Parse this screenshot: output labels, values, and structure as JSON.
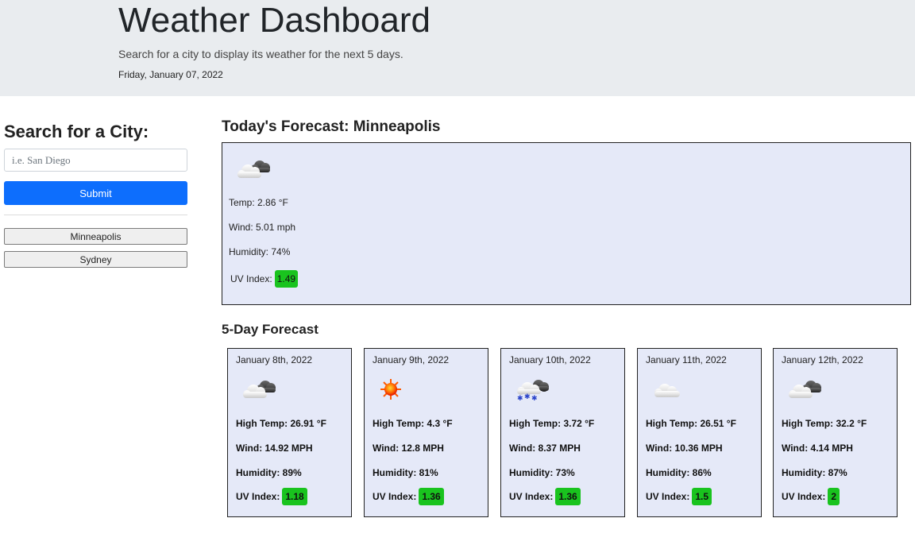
{
  "header": {
    "title": "Weather Dashboard",
    "subtitle": "Search for a city to display its weather for the next 5 days.",
    "date": "Friday, January 07, 2022"
  },
  "sidebar": {
    "heading": "Search for a City:",
    "search_placeholder": "i.e. San Diego",
    "submit_label": "Submit",
    "history": [
      "Minneapolis",
      "Sydney"
    ]
  },
  "today": {
    "heading": "Today's Forecast: Minneapolis",
    "icon": "cloudy-icon",
    "temp": "Temp: 2.86 °F",
    "wind": "Wind: 5.01 mph",
    "humidity": "Humidity: 74%",
    "uv_label": "UV Index:",
    "uv_value": "1.49",
    "uv_color": "#19c31e"
  },
  "forecast": {
    "heading": "5-Day Forecast",
    "uv_label": "UV Index:",
    "days": [
      {
        "date": "January 8th, 2022",
        "icon": "cloudy-icon",
        "high": "High Temp: 26.91 °F",
        "wind": "Wind: 14.92 MPH",
        "humidity": "Humidity: 89%",
        "uv": "1.18"
      },
      {
        "date": "January 9th, 2022",
        "icon": "sun-icon",
        "high": "High Temp: 4.3 °F",
        "wind": "Wind: 12.8 MPH",
        "humidity": "Humidity: 81%",
        "uv": "1.36"
      },
      {
        "date": "January 10th, 2022",
        "icon": "snow-cloud-icon",
        "high": "High Temp: 3.72 °F",
        "wind": "Wind: 8.37 MPH",
        "humidity": "Humidity: 73%",
        "uv": "1.36"
      },
      {
        "date": "January 11th, 2022",
        "icon": "cloud-icon",
        "high": "High Temp: 26.51 °F",
        "wind": "Wind: 10.36 MPH",
        "humidity": "Humidity: 86%",
        "uv": "1.5"
      },
      {
        "date": "January 12th, 2022",
        "icon": "cloudy-icon",
        "high": "High Temp: 32.2 °F",
        "wind": "Wind: 4.14 MPH",
        "humidity": "Humidity: 87%",
        "uv": "2"
      }
    ]
  },
  "colors": {
    "header_bg": "#e9ecef",
    "submit_bg": "#0d6efd",
    "card_bg": "#e5e9f8",
    "uv_good": "#19c31e"
  }
}
